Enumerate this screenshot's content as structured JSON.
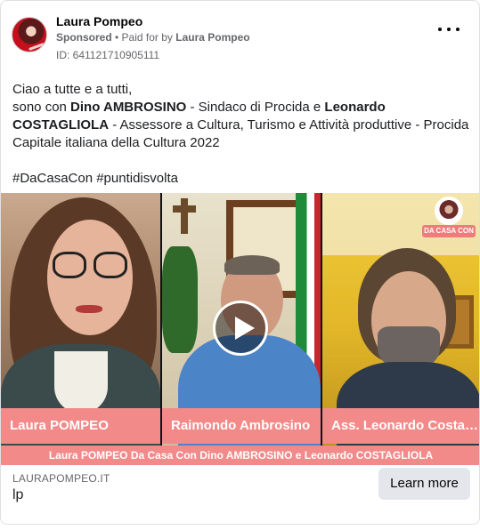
{
  "post": {
    "page_name": "Laura Pompeo",
    "sponsored_label": "Sponsored",
    "paid_for_prefix": "• Paid for by",
    "payer": "Laura Pompeo",
    "ad_id": "ID: 641121710905111"
  },
  "body": {
    "greeting": "Ciao a tutte e a tutti,",
    "intro": "sono con ",
    "guest1": "Dino AMBROSINO",
    "guest1_role": " - Sindaco di Procida e ",
    "guest2": "Leonardo COSTAGLIOLA",
    "guest2_role": " - Assessore a Cultura, Turismo e Attività produttive - Procida Capitale italiana della Cultura 2022",
    "hashtags": "#DaCasaCon #puntidisvolta"
  },
  "video": {
    "logo_label": "DA CASA CON",
    "speakers": [
      {
        "label": "Laura POMPEO"
      },
      {
        "label": "Raimondo Ambrosino"
      },
      {
        "label": "Ass. Leonardo Costagliola"
      }
    ],
    "caption": "Laura POMPEO Da Casa Con Dino AMBROSINO e Leonardo COSTAGLIOLA"
  },
  "footer": {
    "domain": "LAURAPOMPEO.IT",
    "title": "lp",
    "cta_label": "Learn more"
  },
  "colors": {
    "accent_pink": "#f28a8a",
    "cta_bg": "#e4e6eb",
    "meta_gray": "#65676b"
  }
}
